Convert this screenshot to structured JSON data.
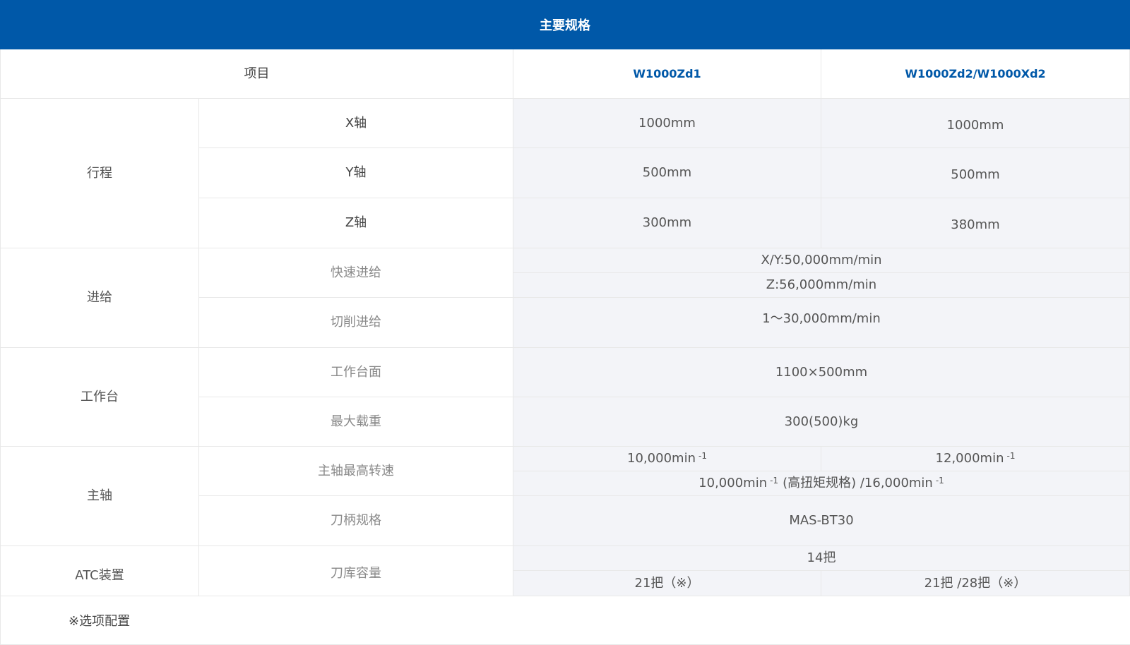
{
  "title": "主要规格",
  "header": {
    "item": "项目",
    "model1": "W1000Zd1",
    "model2": "W1000Zd2/W1000Xd2"
  },
  "rows": {
    "stroke": {
      "category": "行程",
      "x": {
        "label": "X轴",
        "m1": "1000mm",
        "m2": "1000mm"
      },
      "y": {
        "label": "Y轴",
        "m1": "500mm",
        "m2": "500mm"
      },
      "z": {
        "label": "Z轴",
        "m1": "300mm",
        "m2": "380mm"
      }
    },
    "feed": {
      "category": "进给",
      "rapid": {
        "label": "快速进给",
        "line1": "X/Y:50,000mm/min",
        "line2": "Z:56,000mm/min"
      },
      "cutting": {
        "label": "切削进给",
        "value": "1～30,000mm/min"
      }
    },
    "table": {
      "category": "工作台",
      "surface": {
        "label": "工作台面",
        "value": "1100×500mm"
      },
      "load": {
        "label": "最大载重",
        "value": "300(500)kg"
      }
    },
    "spindle": {
      "category": "主轴",
      "speed": {
        "label": "主轴最高转速",
        "m1": "10,000min",
        "m2": "12,000min",
        "sup": "-1",
        "shared_a": "10,000min",
        "shared_mid": "(高扭矩规格) /16,000min"
      },
      "holder": {
        "label": "刀柄规格",
        "value": "MAS-BT30"
      }
    },
    "atc": {
      "category": "ATC装置",
      "capacity": {
        "label": "刀库容量",
        "shared": "14把",
        "m1": "21把（※）",
        "m2": "21把 /28把（※）"
      }
    }
  },
  "note": "※选项配置"
}
